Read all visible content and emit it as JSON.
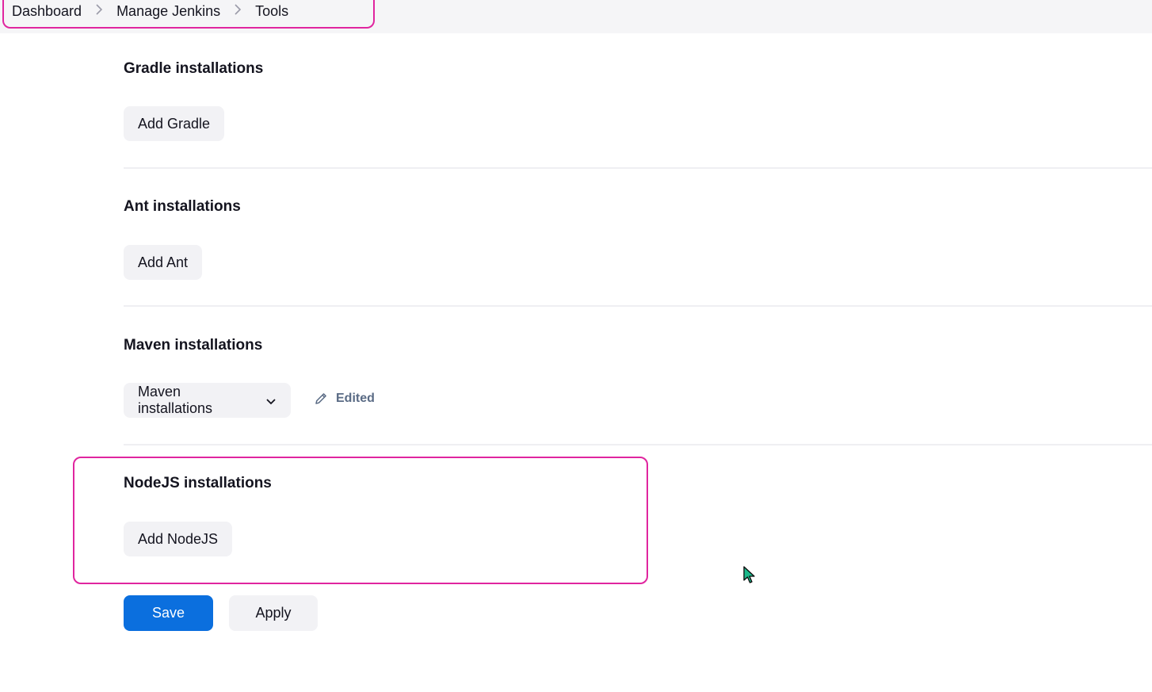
{
  "breadcrumb": {
    "items": [
      "Dashboard",
      "Manage Jenkins",
      "Tools"
    ]
  },
  "sections": {
    "gradle": {
      "title": "Gradle installations",
      "button": "Add Gradle"
    },
    "ant": {
      "title": "Ant installations",
      "button": "Add Ant"
    },
    "maven": {
      "title": "Maven installations",
      "dropdown": "Maven installations",
      "status": "Edited"
    },
    "nodejs": {
      "title": "NodeJS installations",
      "button": "Add NodeJS"
    }
  },
  "actions": {
    "save": "Save",
    "apply": "Apply"
  },
  "colors": {
    "highlight": "#e0259f",
    "primary": "#0b6fde",
    "edited": "#5a6b85"
  }
}
